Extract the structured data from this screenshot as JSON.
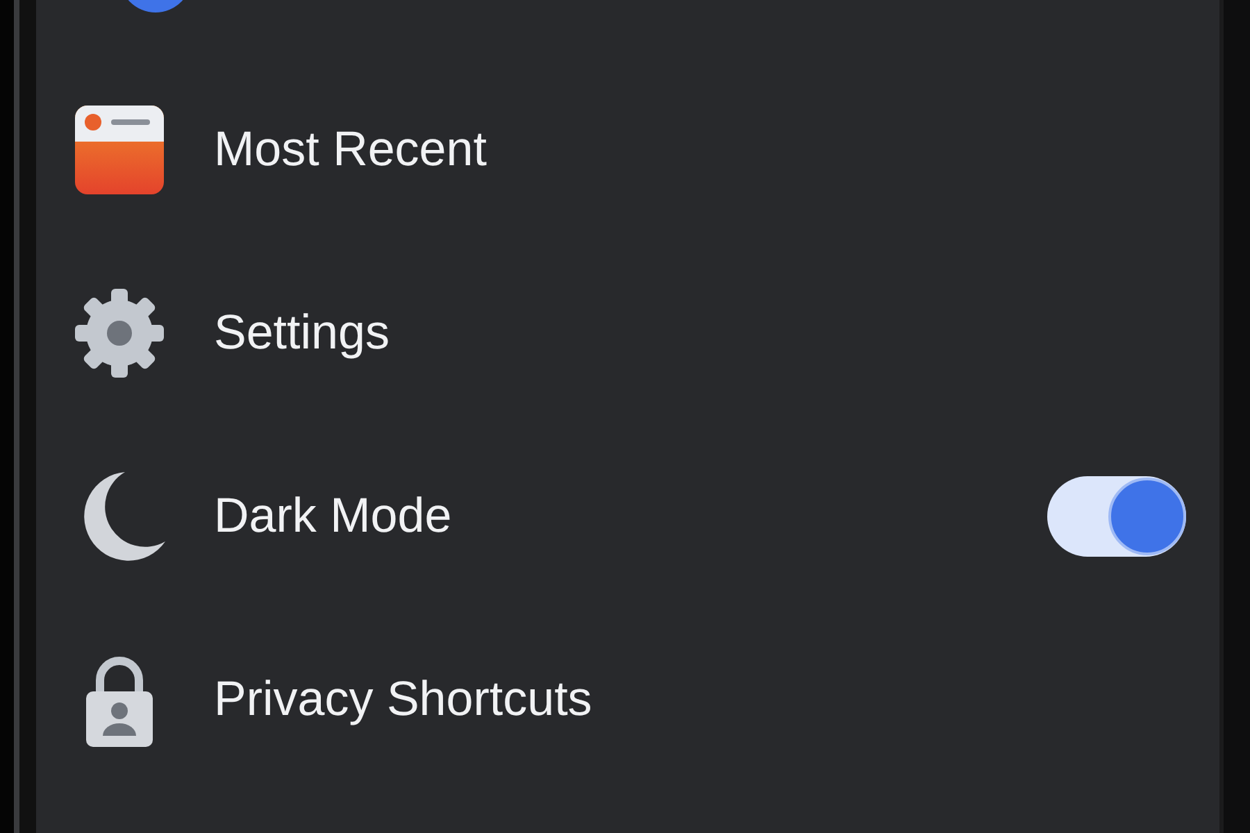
{
  "menu": {
    "items": [
      {
        "kind": "recent",
        "label": "Most Recent"
      },
      {
        "kind": "settings",
        "label": "Settings"
      },
      {
        "kind": "moon",
        "label": "Dark Mode",
        "toggle": {
          "on": true
        }
      },
      {
        "kind": "lock",
        "label": "Privacy Shortcuts"
      }
    ]
  }
}
